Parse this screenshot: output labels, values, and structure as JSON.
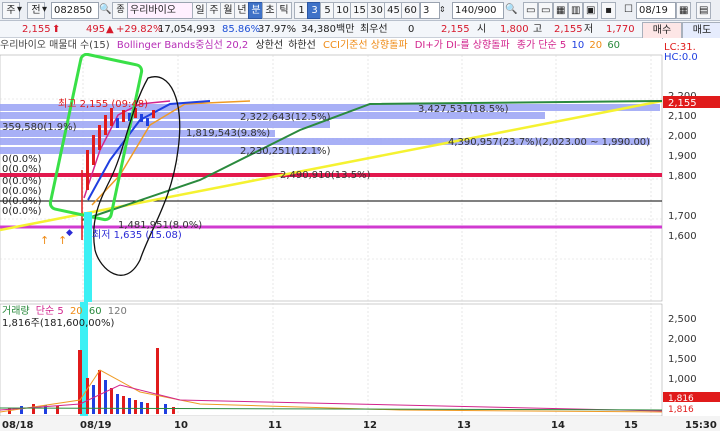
{
  "toolbar": {
    "market": "주",
    "prev": "전",
    "code": "082850",
    "name": "우리바이오",
    "period_tabs": [
      "일",
      "주",
      "월",
      "년",
      "분",
      "초",
      "틱"
    ],
    "minute_buttons": [
      "1",
      "3",
      "5",
      "10",
      "15",
      "30",
      "45",
      "60"
    ],
    "interval": "3",
    "count": "140/900",
    "date": "08/19",
    "price": "2,155",
    "change": "495",
    "change_rate": "+29.82%",
    "volume": "17,054,993",
    "turnover_rate": "85.86%",
    "pct2": "37.97%",
    "amount": "34,380백만",
    "pref_label": "최우선",
    "pref_value": "0",
    "cur_price": "2,155",
    "open_label": "시",
    "open_value": "1,800",
    "high_label": "고",
    "high_value": "2,155",
    "low_label": "저",
    "low_value": "1,770",
    "buy": "매수",
    "sell": "매도"
  },
  "legend": {
    "title": "우리바이오 매물대 수(15)",
    "bb": "Bollinger Bands중심선 20,2",
    "upper": "상한선",
    "lower": "하한선",
    "cci": "CCI기준선 상향돌파",
    "dmi": "DI+가 DI-를 상향돌파",
    "ma_label": "종가 단순 5",
    "ma10": "10",
    "ma20": "20",
    "ma60": "60"
  },
  "right_badges": {
    "lc": "LC:31.",
    "hc": "HC:0.0"
  },
  "price_axis": [
    "2,200",
    "2,100",
    "2,000",
    "1,900",
    "1,800",
    "1,700",
    "1,600"
  ],
  "price_tag": "2,155",
  "volume_axis": [
    "2,500",
    "2,000",
    "1,500",
    "1,000",
    "500"
  ],
  "volume_tags": [
    "1,816",
    "1,816"
  ],
  "volume_legend": {
    "label": "거래량",
    "ma": "단순 5",
    "m20": "20",
    "m60": "60",
    "m120": "120",
    "note": "1,816주(181,600,00%)"
  },
  "time_axis": [
    "08/18",
    "08/19",
    "10",
    "11",
    "12",
    "13",
    "14",
    "15",
    "15:30"
  ],
  "annotations": {
    "high_label": "최고 2,155 (09:48)",
    "low_label": "최저 1,635 (15.08)",
    "pct": [
      "0(0.0%)",
      "0(0.0%)",
      "0(0.0%)",
      "0(0.0%)",
      "0(0.0%)",
      "0(0.0%)"
    ],
    "profiles": [
      "359,580(1.9%)",
      "3,427,531(18.5%)",
      "2,322,643(12.5%)",
      "1,819,543(9.8%)",
      "4,390,957(23.7%)(2,023.00 ~ 1,990.00)",
      "2,230,251(12.1%)",
      "2,490,910(13.5%)",
      "1,481,951(8.0%)"
    ]
  }
}
